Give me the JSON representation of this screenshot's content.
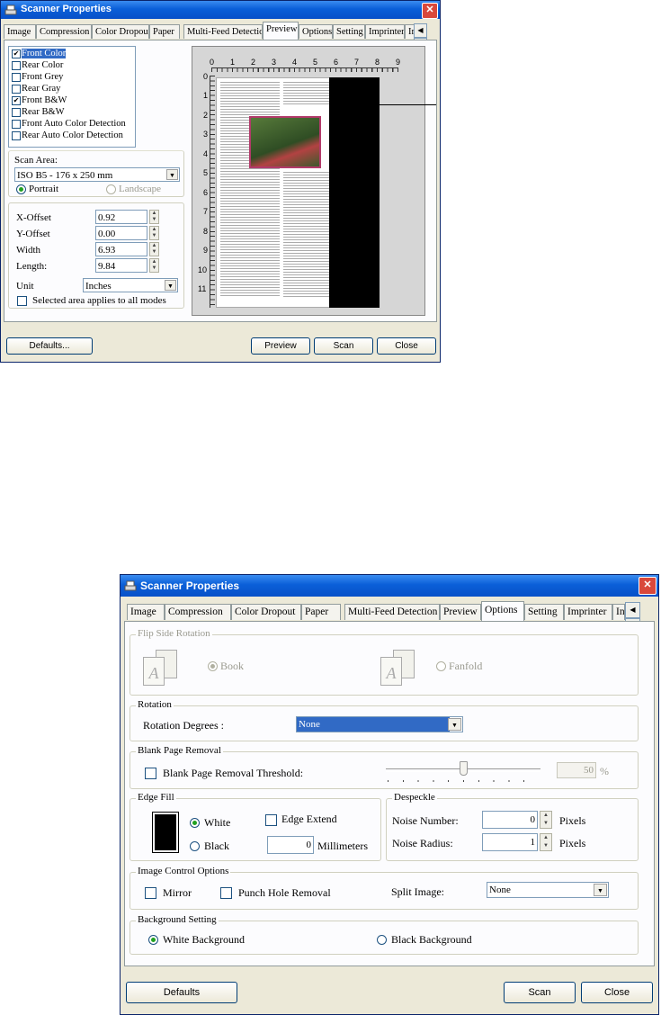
{
  "window1": {
    "title": "Scanner Properties",
    "tabs": [
      "Image",
      "Compression",
      "Color Dropout",
      "Paper",
      "Multi-Feed Detection",
      "Preview",
      "Options",
      "Setting",
      "Imprinter",
      "In"
    ],
    "active_tab": "Preview",
    "image_modes": [
      {
        "label": "Front Color",
        "checked": true,
        "selected": true
      },
      {
        "label": "Rear Color",
        "checked": false
      },
      {
        "label": "Front Grey",
        "checked": false
      },
      {
        "label": "Rear Gray",
        "checked": false
      },
      {
        "label": "Front B&W",
        "checked": true
      },
      {
        "label": "Rear B&W",
        "checked": false
      },
      {
        "label": "Front Auto Color Detection",
        "checked": false
      },
      {
        "label": "Rear Auto Color Detection",
        "checked": false
      }
    ],
    "scan_area_label": "Scan Area:",
    "scan_area_value": "ISO B5 - 176 x 250 mm",
    "portrait_label": "Portrait",
    "landscape_label": "Landscape",
    "x_offset_label": "X-Offset",
    "x_offset_value": "0.92",
    "y_offset_label": "Y-Offset",
    "y_offset_value": "0.00",
    "width_label": "Width",
    "width_value": "6.93",
    "length_label": "Length:",
    "length_value": "9.84",
    "unit_label": "Unit",
    "unit_value": "Inches",
    "apply_all_label": "Selected area applies to all modes",
    "ruler_h": [
      "0",
      "1",
      "2",
      "3",
      "4",
      "5",
      "6",
      "7",
      "8",
      "9"
    ],
    "ruler_v": [
      "0",
      "1",
      "2",
      "3",
      "4",
      "5",
      "6",
      "7",
      "8",
      "9",
      "10",
      "11"
    ],
    "defaults_label": "Defaults...",
    "preview_label": "Preview",
    "scan_label": "Scan",
    "close_label": "Close"
  },
  "window2": {
    "title": "Scanner Properties",
    "tabs": [
      "Image",
      "Compression",
      "Color Dropout",
      "Paper",
      "Multi-Feed Detection",
      "Preview",
      "Options",
      "Setting",
      "Imprinter",
      "In"
    ],
    "active_tab": "Options",
    "flip_side": {
      "legend": "Flip Side Rotation",
      "book_label": "Book",
      "fanfold_label": "Fanfold",
      "icon_letter": "A"
    },
    "rotation": {
      "legend": "Rotation",
      "label": "Rotation Degrees :",
      "value": "None"
    },
    "blank_page": {
      "legend": "Blank Page Removal",
      "label": "Blank Page Removal Threshold:",
      "value": "50",
      "unit": "%",
      "slider_level_percent": 50
    },
    "edge_fill": {
      "legend": "Edge Fill",
      "white_label": "White",
      "black_label": "Black",
      "extend_label": "Edge Extend",
      "mm_value": "0",
      "mm_label": "Millimeters"
    },
    "despeckle": {
      "legend": "Despeckle",
      "noise_number_label": "Noise Number:",
      "noise_number_value": "0",
      "noise_radius_label": "Noise Radius:",
      "noise_radius_value": "1",
      "unit": "Pixels"
    },
    "image_control": {
      "legend": "Image Control Options",
      "mirror_label": "Mirror",
      "punch_label": "Punch Hole Removal",
      "split_label": "Split Image:",
      "split_value": "None"
    },
    "background": {
      "legend": "Background Setting",
      "white_label": "White Background",
      "black_label": "Black Background"
    },
    "defaults_label": "Defaults",
    "scan_label": "Scan",
    "close_label": "Close"
  },
  "colors": {
    "titlebar": "#0a5fd8",
    "selection": "#316ac5",
    "window_bg": "#ece9d8",
    "close": "#d9483b"
  }
}
